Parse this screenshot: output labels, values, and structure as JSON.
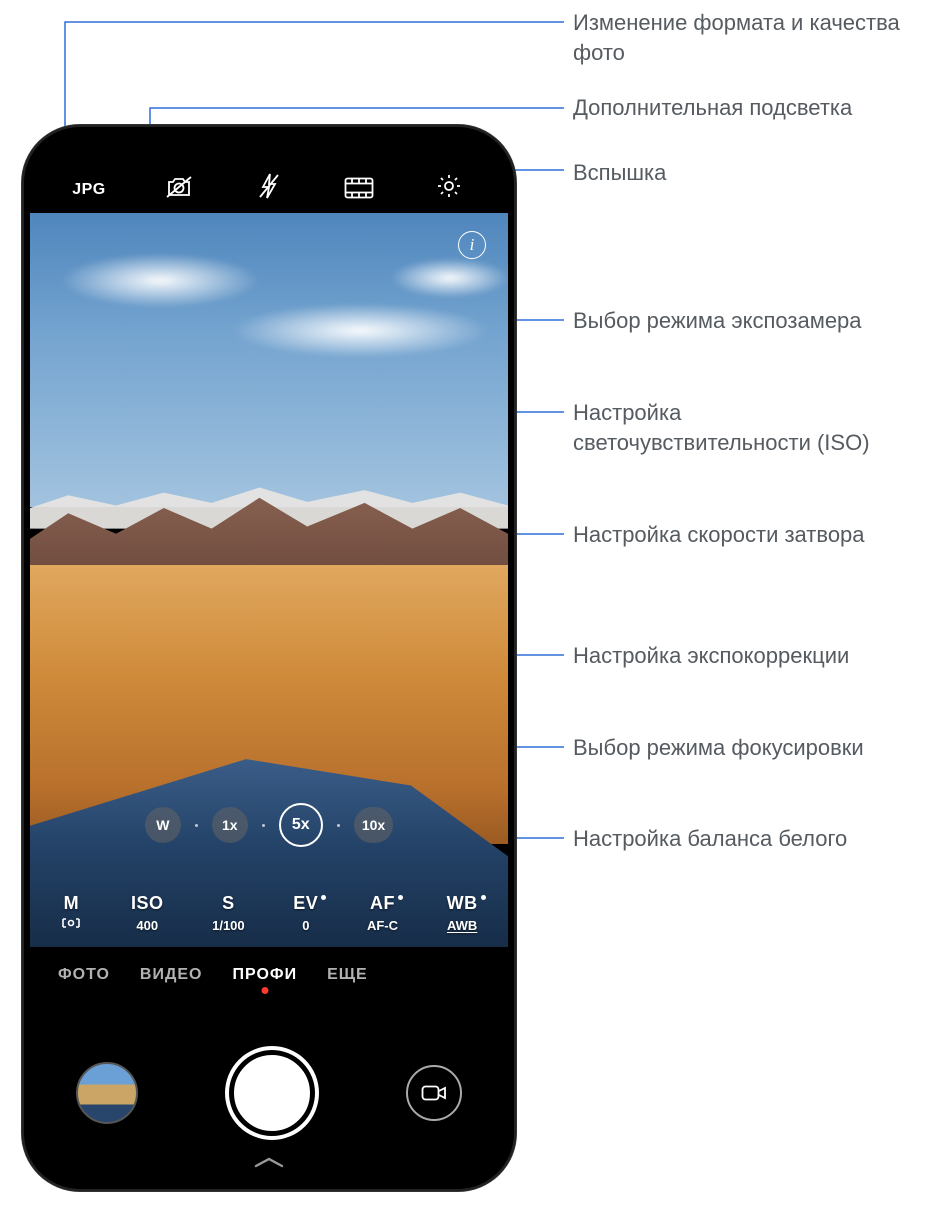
{
  "annotations": {
    "format": "Изменение формата и качества фото",
    "light": "Дополнительная подсветка",
    "flash": "Вспышка",
    "metering": "Выбор режима экспозамера",
    "iso": "Настройка светочувствительности (ISO)",
    "shutter": "Настройка скорости затвора",
    "ev": "Настройка экспокоррекции",
    "focus": "Выбор режима фокусировки",
    "wb": "Настройка баланса белого"
  },
  "topbar": {
    "format_label": "JPG"
  },
  "info_label": "i",
  "zoom": {
    "items": [
      {
        "label": "W",
        "active": false
      },
      {
        "label": "1x",
        "active": false
      },
      {
        "label": "5x",
        "active": true
      },
      {
        "label": "10x",
        "active": false
      }
    ]
  },
  "pro": {
    "m": {
      "label": "M"
    },
    "iso": {
      "label": "ISO",
      "value": "400"
    },
    "s": {
      "label": "S",
      "value": "1/100"
    },
    "ev": {
      "label": "EV",
      "value": "0"
    },
    "af": {
      "label": "AF",
      "value": "AF-C"
    },
    "wb": {
      "label": "WB",
      "value": "AWB"
    }
  },
  "modes": {
    "items": [
      "ФОТО",
      "ВИДЕО",
      "ПРОФИ",
      "ЕЩЕ"
    ],
    "active_index": 2
  }
}
